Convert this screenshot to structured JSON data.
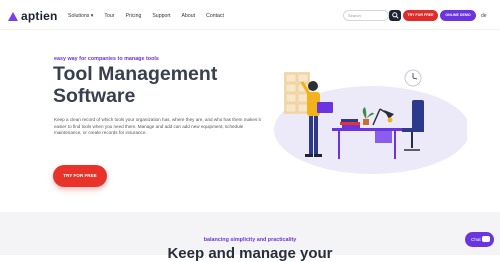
{
  "header": {
    "logo_text": "aptien",
    "nav": [
      "Solutions ▾",
      "Tour",
      "Pricing",
      "Support",
      "About",
      "Contact"
    ],
    "search": {
      "placeholder": "Search"
    },
    "trial_label": "TRY FOR FREE",
    "demo_label": "ONLINE DEMO",
    "lang": "de"
  },
  "hero": {
    "eyebrow": "easy way for companies to manage tools",
    "title_line1": "Tool Management",
    "title_line2": "Software",
    "description": "Keep a clean record of which tools your organization has, where they are, and who has them makes it easier to find tools when you need them. Manage and add can add new equipment, schedule maintenance, or create records for insurance.",
    "cta_label": "TRY FOR FREE"
  },
  "section2": {
    "eyebrow": "balancing simplicity and practicality",
    "title": "Keep and manage your"
  },
  "chat": {
    "label": "Chat"
  },
  "colors": {
    "accent_purple": "#6a35e0",
    "accent_red": "#e8332b",
    "dark": "#1f2330"
  }
}
